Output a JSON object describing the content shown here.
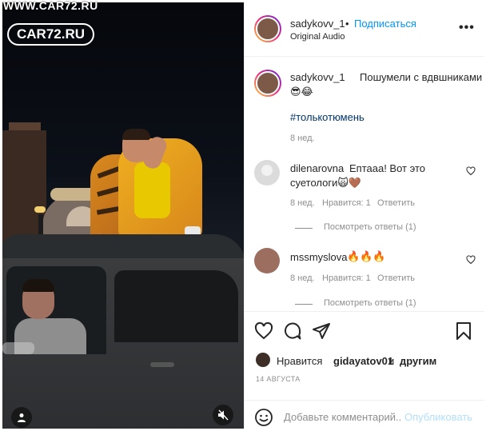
{
  "watermark": {
    "top_text": "WWW.CAR72.RU",
    "logo_text": "CAR72.RU"
  },
  "media": {
    "user_tags_icon": "person-icon",
    "mute_icon": "speaker-muted-icon"
  },
  "header": {
    "username": "sadykovv_1",
    "dot": "•",
    "follow_label": "Подписаться",
    "audio_label": "Original Audio",
    "more_icon": "more-dots-icon",
    "more_label": "•••"
  },
  "caption": {
    "username": "sadykovv_1",
    "text": "Пошумели с вдвшниками",
    "emoji": "😎😂",
    "hashtag": "#толькотюмень",
    "time": "8 нед."
  },
  "comments": [
    {
      "username": "dilenarovna",
      "text_line1": "Ептааа! Вот это",
      "text_line2": "суетологи🙀🤎",
      "time": "8 нед.",
      "likes": "Нравится: 1",
      "reply_label": "Ответить",
      "view_replies": "Посмотреть ответы (1)"
    },
    {
      "username": "mssmyslova",
      "text_line1": "🔥🔥🔥",
      "time": "8 нед.",
      "likes": "Нравится: 1",
      "reply_label": "Ответить",
      "view_replies": "Посмотреть ответы (1)"
    }
  ],
  "actions": {
    "like_icon": "heart-icon",
    "comment_icon": "comment-bubble-icon",
    "share_icon": "paper-plane-icon",
    "save_icon": "bookmark-icon"
  },
  "likes": {
    "prefix": "Нравится",
    "user": "gidayatov01",
    "connector": "и",
    "others": "другим"
  },
  "date": "14 АВГУСТА",
  "comment_box": {
    "placeholder": "Добавьте комментарий...",
    "publish_label": "Опубликовать",
    "emoji_icon": "smiley-icon"
  },
  "colors": {
    "accent": "#0095f6",
    "hashtag": "#00376b",
    "muted": "#8e8e8e",
    "publish_disabled": "#b2dffc"
  }
}
